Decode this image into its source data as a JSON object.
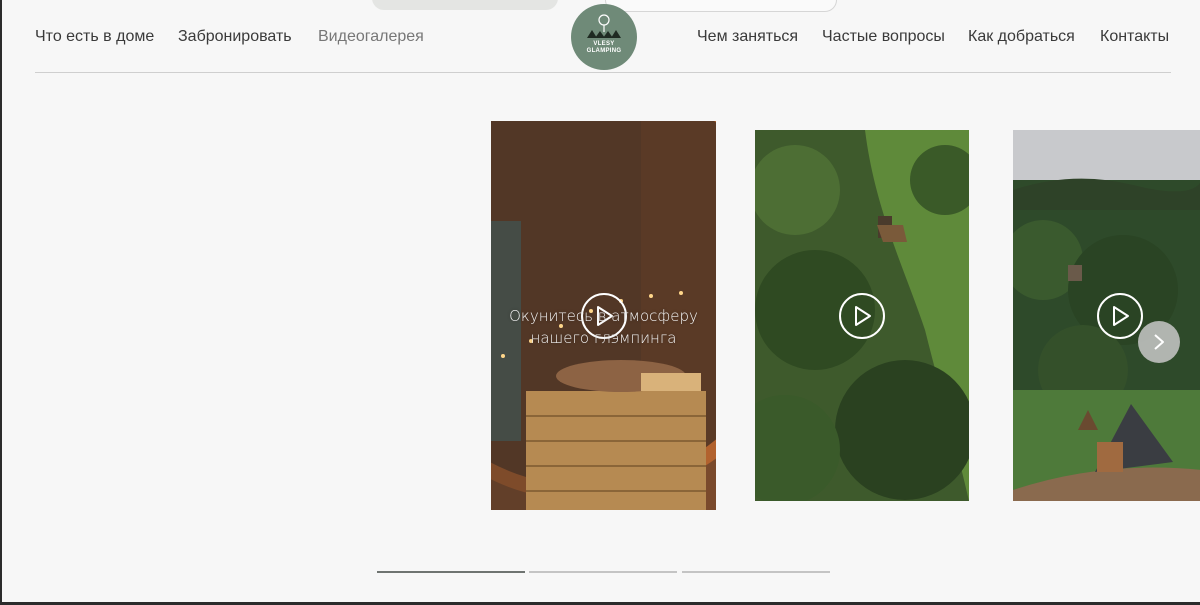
{
  "nav": {
    "left": [
      {
        "label": "Что есть в доме"
      },
      {
        "label": "Забронировать"
      },
      {
        "label": "Видеогалерея"
      }
    ],
    "right": [
      {
        "label": "Чем заняться"
      },
      {
        "label": "Частые вопросы"
      },
      {
        "label": "Как добраться"
      },
      {
        "label": "Контакты"
      }
    ]
  },
  "logo": {
    "line1": "VLESY",
    "line2": "GLAMPING",
    "color": "#6f8a78"
  },
  "gallery": {
    "videos": [
      {
        "caption_line1": "Окунитесь в атмосферу",
        "caption_line2": "нашего глэмпинга",
        "icon": "play-icon"
      },
      {
        "icon": "play-icon"
      },
      {
        "icon": "play-icon"
      }
    ],
    "next_icon": "chevron-right-icon",
    "pagination": {
      "total": 3,
      "active": 1
    }
  }
}
